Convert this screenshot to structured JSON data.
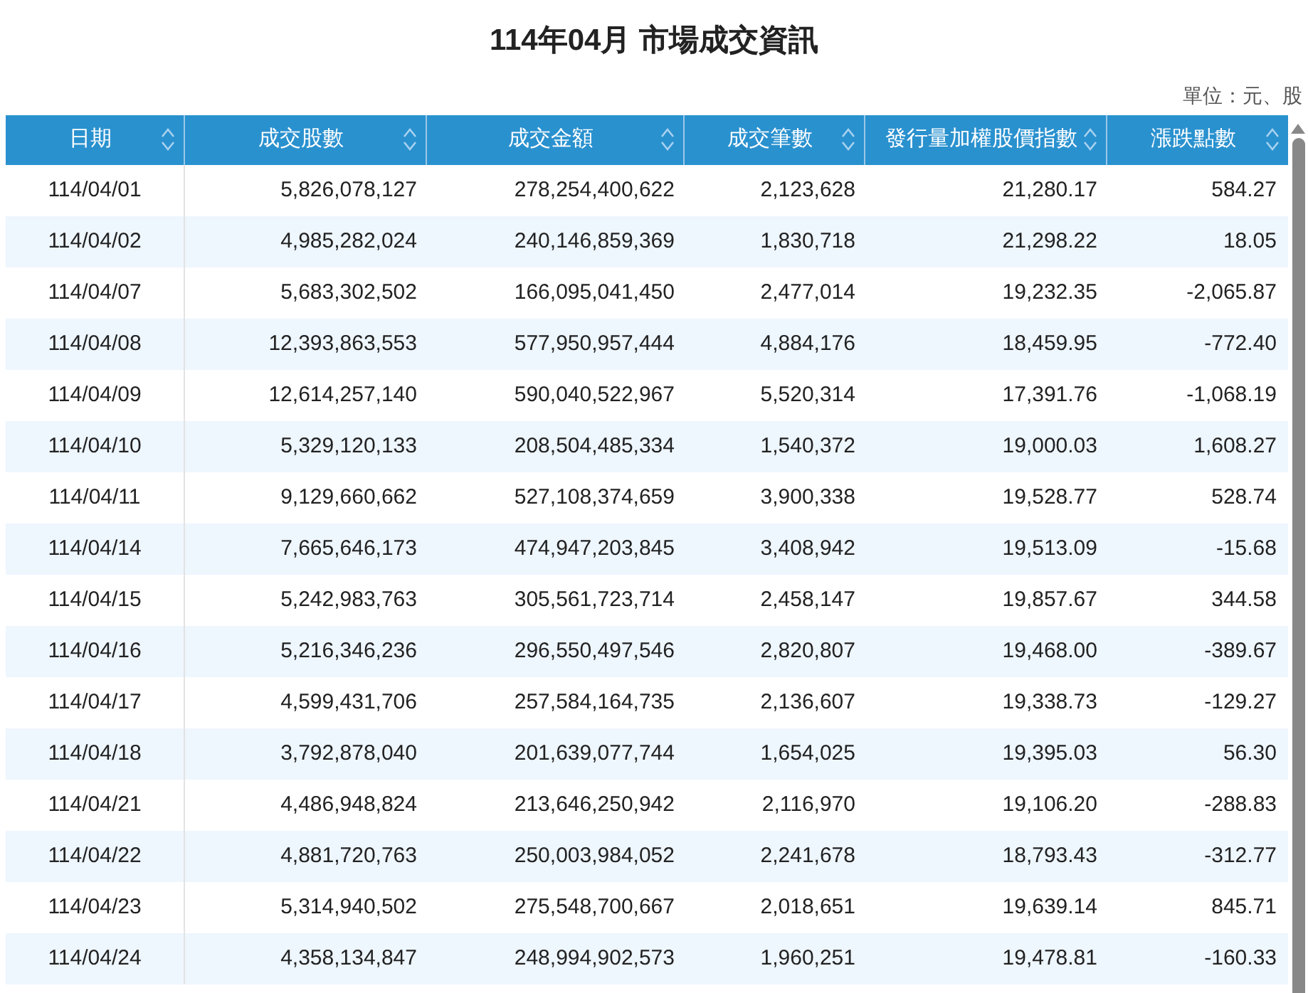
{
  "title": "114年04月 市場成交資訊",
  "unit": "單位：元、股",
  "table": {
    "columns": [
      {
        "label": "日期"
      },
      {
        "label": "成交股數"
      },
      {
        "label": "成交金額"
      },
      {
        "label": "成交筆數"
      },
      {
        "label": "發行量加權股價指數"
      },
      {
        "label": "漲跌點數"
      }
    ],
    "rows": [
      [
        "114/04/01",
        "5,826,078,127",
        "278,254,400,622",
        "2,123,628",
        "21,280.17",
        "584.27"
      ],
      [
        "114/04/02",
        "4,985,282,024",
        "240,146,859,369",
        "1,830,718",
        "21,298.22",
        "18.05"
      ],
      [
        "114/04/07",
        "5,683,302,502",
        "166,095,041,450",
        "2,477,014",
        "19,232.35",
        "-2,065.87"
      ],
      [
        "114/04/08",
        "12,393,863,553",
        "577,950,957,444",
        "4,884,176",
        "18,459.95",
        "-772.40"
      ],
      [
        "114/04/09",
        "12,614,257,140",
        "590,040,522,967",
        "5,520,314",
        "17,391.76",
        "-1,068.19"
      ],
      [
        "114/04/10",
        "5,329,120,133",
        "208,504,485,334",
        "1,540,372",
        "19,000.03",
        "1,608.27"
      ],
      [
        "114/04/11",
        "9,129,660,662",
        "527,108,374,659",
        "3,900,338",
        "19,528.77",
        "528.74"
      ],
      [
        "114/04/14",
        "7,665,646,173",
        "474,947,203,845",
        "3,408,942",
        "19,513.09",
        "-15.68"
      ],
      [
        "114/04/15",
        "5,242,983,763",
        "305,561,723,714",
        "2,458,147",
        "19,857.67",
        "344.58"
      ],
      [
        "114/04/16",
        "5,216,346,236",
        "296,550,497,546",
        "2,820,807",
        "19,468.00",
        "-389.67"
      ],
      [
        "114/04/17",
        "4,599,431,706",
        "257,584,164,735",
        "2,136,607",
        "19,338.73",
        "-129.27"
      ],
      [
        "114/04/18",
        "3,792,878,040",
        "201,639,077,744",
        "1,654,025",
        "19,395.03",
        "56.30"
      ],
      [
        "114/04/21",
        "4,486,948,824",
        "213,646,250,942",
        "2,116,970",
        "19,106.20",
        "-288.83"
      ],
      [
        "114/04/22",
        "4,881,720,763",
        "250,003,984,052",
        "2,241,678",
        "18,793.43",
        "-312.77"
      ],
      [
        "114/04/23",
        "5,314,940,502",
        "275,548,700,667",
        "2,018,651",
        "19,639.14",
        "845.71"
      ],
      [
        "114/04/24",
        "4,358,134,847",
        "248,994,902,573",
        "1,960,251",
        "19,478.81",
        "-160.33"
      ]
    ]
  }
}
